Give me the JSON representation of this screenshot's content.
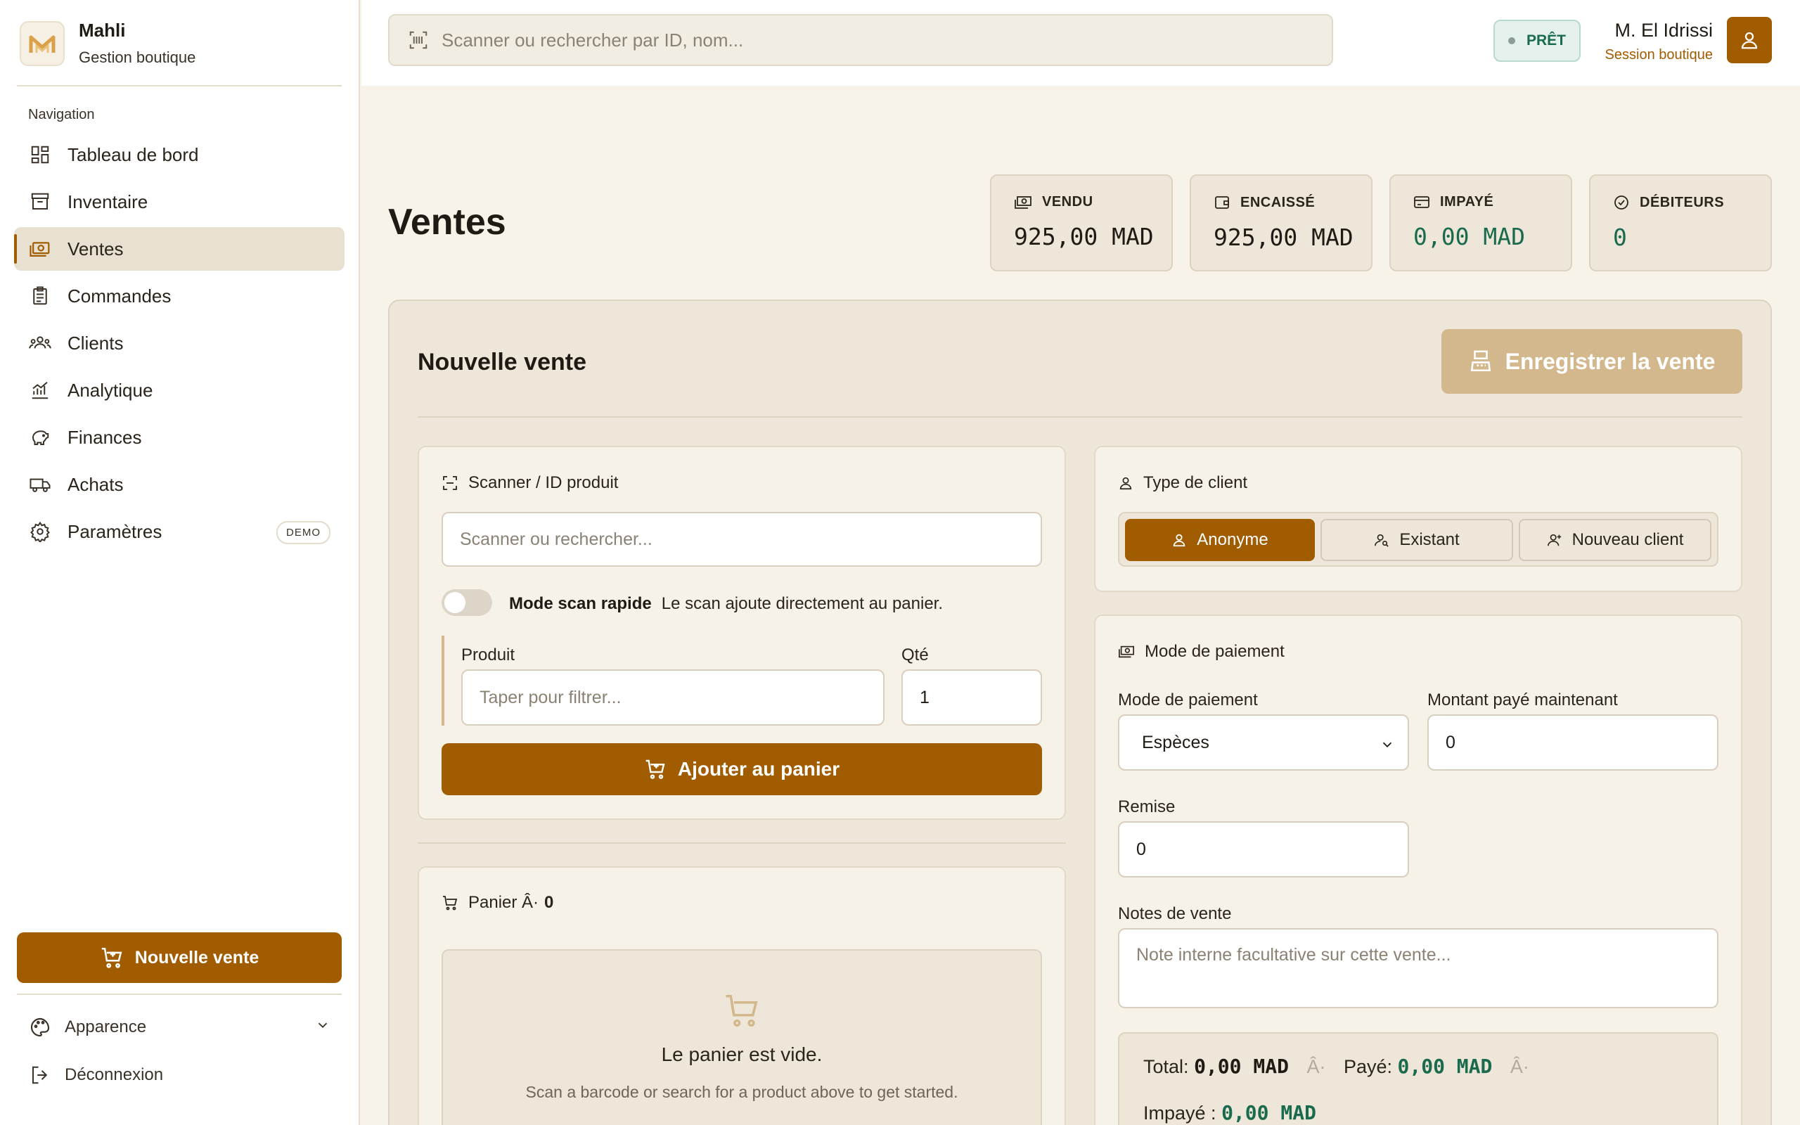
{
  "brand": {
    "name": "Mahli",
    "subtitle": "Gestion boutique"
  },
  "nav": {
    "heading": "Navigation",
    "items": [
      {
        "label": "Tableau de bord",
        "icon": "dashboard-icon"
      },
      {
        "label": "Inventaire",
        "icon": "archive-icon"
      },
      {
        "label": "Ventes",
        "icon": "banknotes-icon",
        "active": true
      },
      {
        "label": "Commandes",
        "icon": "clipboard-icon"
      },
      {
        "label": "Clients",
        "icon": "users-icon"
      },
      {
        "label": "Analytique",
        "icon": "chart-icon"
      },
      {
        "label": "Finances",
        "icon": "piggy-bank-icon"
      },
      {
        "label": "Achats",
        "icon": "truck-icon"
      },
      {
        "label": "Paramètres",
        "icon": "gear-icon",
        "badge": "DEMO"
      }
    ]
  },
  "sidebar_footer": {
    "cta_label": "Nouvelle vente",
    "appearance_label": "Apparence",
    "logout_label": "Déconnexion"
  },
  "topbar": {
    "search_placeholder": "Scanner ou rechercher par ID, nom...",
    "status": "PRÊT",
    "user_name": "M. El Idrissi",
    "user_role": "Session boutique"
  },
  "page": {
    "title": "Ventes",
    "stats": [
      {
        "label": "VENDU",
        "value": "925,00 MAD",
        "icon": "cash-icon"
      },
      {
        "label": "ENCAISSÉ",
        "value": "925,00 MAD",
        "icon": "wallet-icon"
      },
      {
        "label": "IMPAYÉ",
        "value": "0,00 MAD",
        "icon": "card-icon",
        "color": "#1a6b4e"
      },
      {
        "label": "DÉBITEURS",
        "value": "0",
        "icon": "check-circle-icon",
        "color": "#1a6b4e"
      }
    ]
  },
  "sale": {
    "title": "Nouvelle vente",
    "save_label": "Enregistrer la vente",
    "scanner": {
      "title": "Scanner / ID produit",
      "placeholder": "Scanner ou rechercher...",
      "quick_scan_label": "Mode scan rapide",
      "quick_scan_hint": "Le scan ajoute directement au panier.",
      "quick_scan_on": false,
      "product_label": "Produit",
      "product_placeholder": "Taper pour filtrer...",
      "qty_label": "Qté",
      "qty_value": "1",
      "add_label": "Ajouter au panier"
    },
    "cart": {
      "title": "Panier Â·",
      "count": "0",
      "empty_title": "Le panier est vide.",
      "empty_sub": "Scan a barcode or search for a product above to get started."
    },
    "client": {
      "title": "Type de client",
      "options": [
        "Anonyme",
        "Existant",
        "Nouveau client"
      ],
      "selected": "Anonyme"
    },
    "payment": {
      "title": "Mode de paiement",
      "mode_label": "Mode de paiement",
      "mode_value": "Espèces",
      "paid_label": "Montant payé maintenant",
      "paid_value": "0",
      "discount_label": "Remise",
      "discount_value": "0",
      "notes_label": "Notes de vente",
      "notes_placeholder": "Note interne facultative sur cette vente..."
    },
    "totals": {
      "total_label": "Total:",
      "total_value": "0,00 MAD",
      "sep": "Â·",
      "paid_label": "Payé:",
      "paid_value": "0,00 MAD",
      "unpaid_label": "Impayé :",
      "unpaid_value": "0,00 MAD"
    }
  },
  "colors": {
    "accent": "#a25c00",
    "accent_disabled": "#d4b88d",
    "positive": "#1a6b4e",
    "background": "#f8f3e9"
  }
}
